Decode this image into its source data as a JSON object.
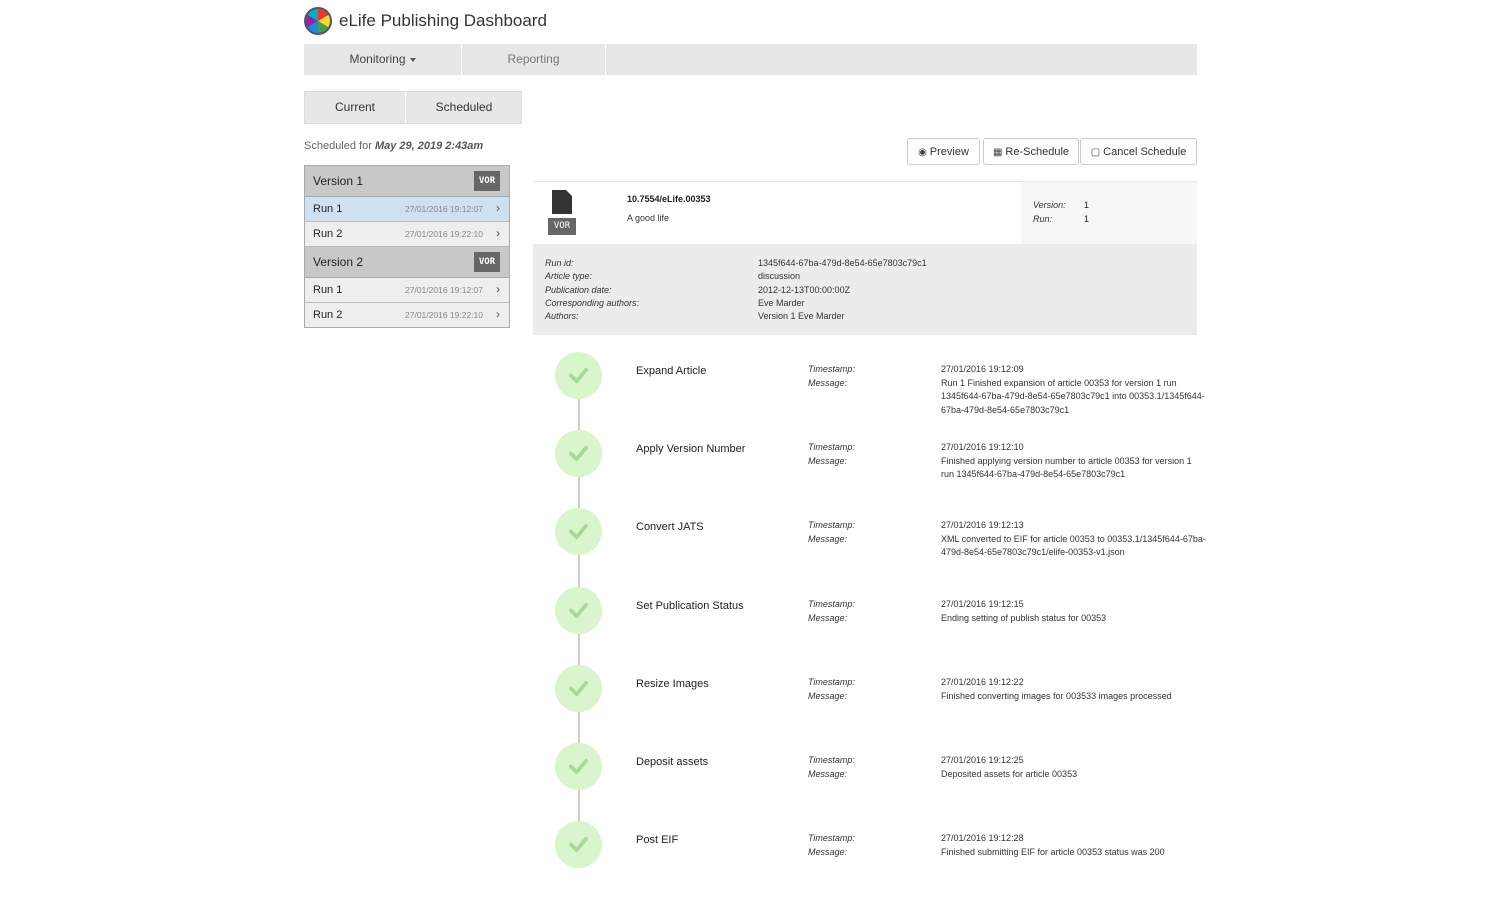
{
  "app": {
    "title": "eLife Publishing Dashboard"
  },
  "nav": {
    "monitoring": "Monitoring",
    "reporting": "Reporting"
  },
  "subtabs": {
    "current": "Current",
    "scheduled": "Scheduled"
  },
  "schedule": {
    "prefix": "Scheduled for",
    "date": "May 29, 2019 2:43am"
  },
  "versions": [
    {
      "label": "Version 1",
      "badge": "VOR",
      "runs": [
        {
          "label": "Run 1",
          "time": "27/01/2016 19:12:07",
          "active": true
        },
        {
          "label": "Run 2",
          "time": "27/01/2016 19:22:10",
          "active": false
        }
      ]
    },
    {
      "label": "Version 2",
      "badge": "VOR",
      "runs": [
        {
          "label": "Run 1",
          "time": "27/01/2016 19:12:07",
          "active": false
        },
        {
          "label": "Run 2",
          "time": "27/01/2016 19:22:10",
          "active": false
        }
      ]
    }
  ],
  "buttons": {
    "preview": "Preview",
    "reschedule": "Re-Schedule",
    "cancel": "Cancel Schedule"
  },
  "article": {
    "badge": "VOR",
    "doi": "10.7554/eLife.00353",
    "title": "A good life",
    "version_label": "Version:",
    "version": "1",
    "run_label": "Run:",
    "run": "1"
  },
  "details": {
    "run_id_label": "Run id:",
    "run_id": "1345f644-67ba-479d-8e54-65e7803c79c1",
    "type_label": "Article type:",
    "type": "discussion",
    "pubdate_label": "Publication date:",
    "pubdate": "2012-12-13T00:00:00Z",
    "corr_label": "Corresponding authors:",
    "corr": "Eve Marder",
    "authors_label": "Authors:",
    "authors": "Version 1 Eve Marder"
  },
  "labels": {
    "timestamp": "Timestamp:",
    "message": "Message:"
  },
  "steps": [
    {
      "name": "Expand Article",
      "timestamp": "27/01/2016 19:12:09",
      "message": "Run 1 Finished expansion of article 00353 for version 1 run 1345f644-67ba-479d-8e54-65e7803c79c1 into 00353.1/1345f644-67ba-479d-8e54-65e7803c79c1",
      "status": "success"
    },
    {
      "name": "Apply Version Number",
      "timestamp": "27/01/2016 19:12:10",
      "message": "Finished applying version number to article 00353 for version 1 run 1345f644-67ba-479d-8e54-65e7803c79c1",
      "status": "success"
    },
    {
      "name": "Convert JATS",
      "timestamp": "27/01/2016 19:12:13",
      "message": "XML converted to EIF for article 00353 to 00353.1/1345f644-67ba-479d-8e54-65e7803c79c1/elife-00353-v1.json",
      "status": "success"
    },
    {
      "name": "Set Publication Status",
      "timestamp": "27/01/2016 19:12:15",
      "message": "Ending setting of publish status for 00353",
      "status": "success"
    },
    {
      "name": "Resize Images",
      "timestamp": "27/01/2016 19:12:22",
      "message": "Finished converting images for 003533 images processed",
      "status": "success"
    },
    {
      "name": "Deposit assets",
      "timestamp": "27/01/2016 19:12:25",
      "message": "Deposited assets for article 00353",
      "status": "success"
    },
    {
      "name": "Post EIF",
      "timestamp": "27/01/2016 19:12:28",
      "message": "Finished submitting EIF for article 00353 status was 200",
      "status": "success"
    }
  ],
  "colors": {
    "success_circle": "#d9f5cc",
    "check": "#a9d89a",
    "active_run": "#cfe0f0"
  }
}
